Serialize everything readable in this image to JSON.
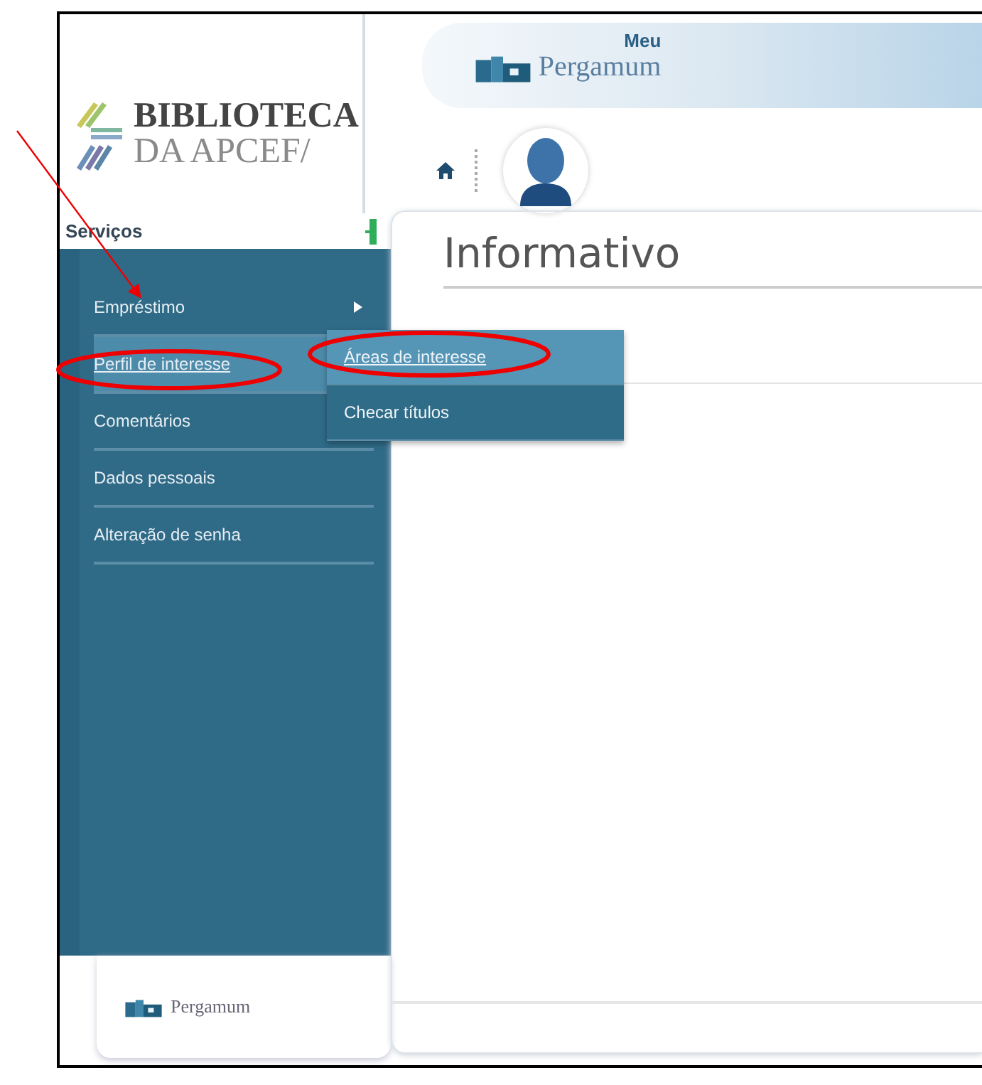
{
  "header": {
    "logo_line_1": "BIBLIOTECA",
    "logo_line_2": "DA APCEF/",
    "app_logo_top": "Meu",
    "app_logo_name": "Pergamum"
  },
  "sidebar": {
    "title": "Serviços",
    "items": [
      {
        "label": "Empréstimo",
        "selected": false,
        "submenu_arrow": true
      },
      {
        "label": "Perfil de interesse",
        "selected": true,
        "submenu_arrow": false
      },
      {
        "label": "Comentários",
        "selected": false,
        "submenu_arrow": false
      },
      {
        "label": "Dados pessoais",
        "selected": false,
        "submenu_arrow": false
      },
      {
        "label": "Alteração de senha",
        "selected": false,
        "submenu_arrow": false
      }
    ],
    "footer_logo": "Pergamum"
  },
  "submenu": {
    "items": [
      {
        "label": "Áreas de interesse",
        "selected": true
      },
      {
        "label": "Checar títulos",
        "selected": false
      }
    ]
  },
  "content": {
    "title": "Informativo"
  }
}
